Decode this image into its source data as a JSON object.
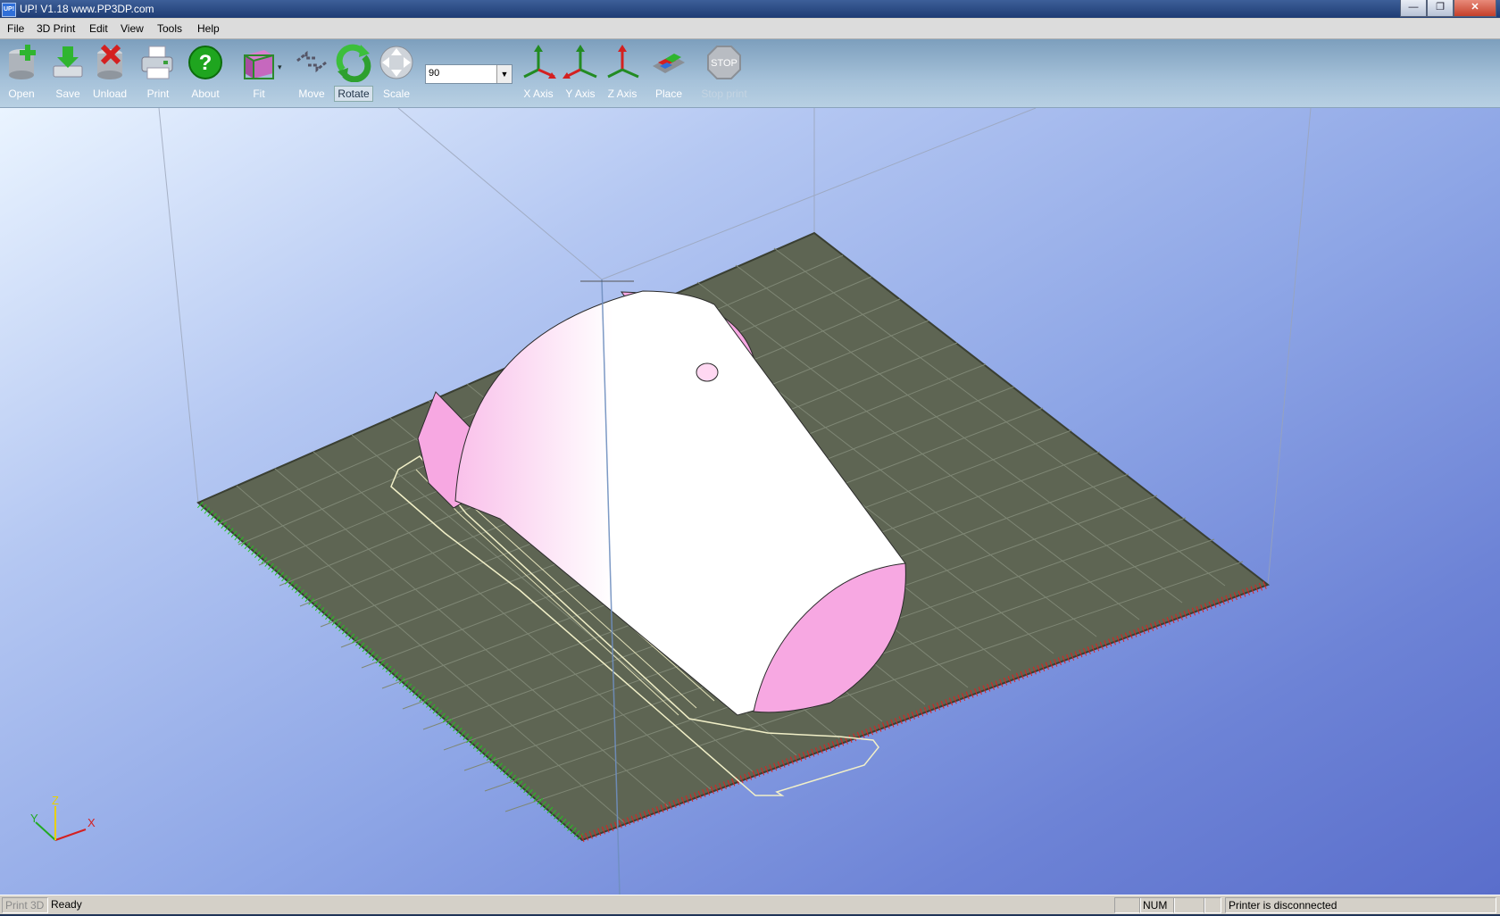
{
  "window": {
    "title": "UP!  V1.18  www.PP3DP.com",
    "app_icon": "UP!",
    "btn_minimize": "—",
    "btn_restore": "❐",
    "btn_close": "✕"
  },
  "menu": [
    {
      "label": "File"
    },
    {
      "label": "3D Print"
    },
    {
      "label": "Edit"
    },
    {
      "label": "View"
    },
    {
      "label": "Tools"
    },
    {
      "label": "Help"
    }
  ],
  "toolbar": {
    "open": "Open",
    "save": "Save",
    "unload": "Unload",
    "print": "Print",
    "about": "About",
    "fit": "Fit",
    "move": "Move",
    "rotate": "Rotate",
    "scale": "Scale",
    "angle_value": "90",
    "x_axis": "X Axis",
    "y_axis": "Y Axis",
    "z_axis": "Z Axis",
    "place": "Place",
    "stop_print": "Stop print",
    "stop_sign": "STOP"
  },
  "viewport": {
    "axis_x": "X",
    "axis_y": "Y",
    "axis_z": "Z"
  },
  "colors": {
    "platform": "#5e6553",
    "model_face": "#ffffff",
    "model_side": "#f7a8e2",
    "x_ruler": "#e02020",
    "y_ruler": "#22c41e"
  },
  "status": {
    "print3d": "Print 3D",
    "ready": "Ready",
    "num": "NUM",
    "printer": "Printer is disconnected"
  }
}
